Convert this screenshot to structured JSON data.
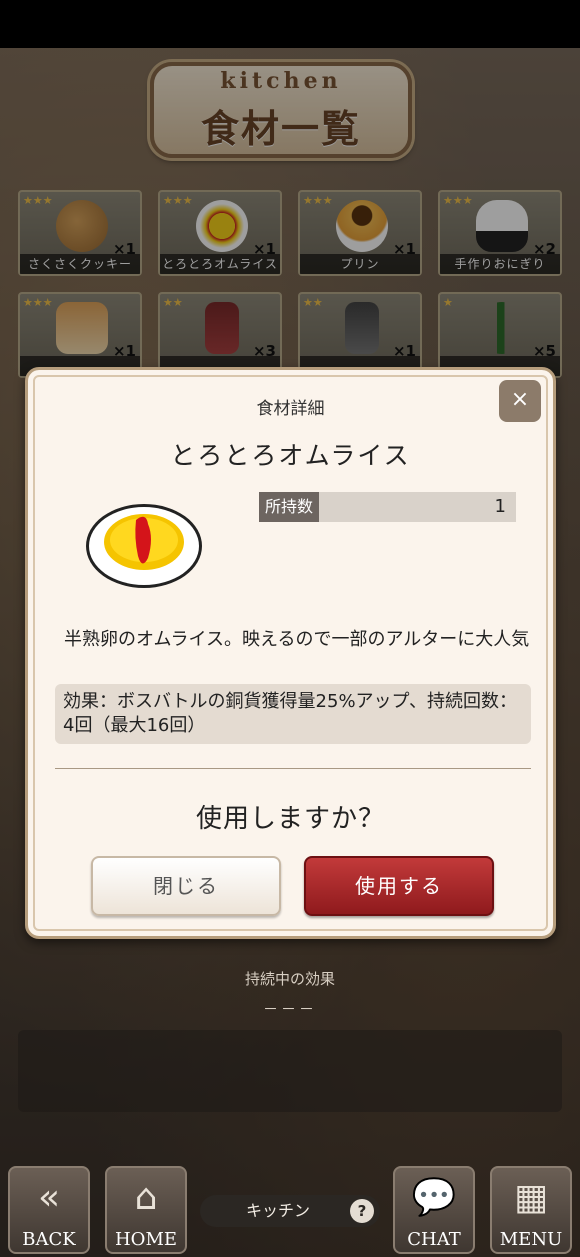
{
  "header": {
    "kitchen_label": "kitchen",
    "title": "食材一覧"
  },
  "ingredients": [
    {
      "name": "さくさくクッキー",
      "qty": "×1",
      "stars": "★★★"
    },
    {
      "name": "とろとろオムライス",
      "qty": "×1",
      "stars": "★★★"
    },
    {
      "name": "プリン",
      "qty": "×1",
      "stars": "★★★"
    },
    {
      "name": "手作りおにぎり",
      "qty": "×2",
      "stars": "★★★"
    },
    {
      "name": "",
      "qty": "×1",
      "stars": "★★★"
    },
    {
      "name": "",
      "qty": "×3",
      "stars": "★★"
    },
    {
      "name": "",
      "qty": "×1",
      "stars": "★★"
    },
    {
      "name": "",
      "qty": "×5",
      "stars": "★"
    }
  ],
  "modal": {
    "title": "食材詳細",
    "close_icon": "×",
    "item_name": "とろとろオムライス",
    "owned_label": "所持数",
    "owned_value": "1",
    "description": "半熟卵のオムライス。映えるので一部のアルターに大人気",
    "effect": "効果：ボスバトルの銅貨獲得量25%アップ、持続回数：4回（最大16回）",
    "confirm_text": "使用しますか？",
    "close_button": "閉じる",
    "use_button": "使用する"
  },
  "effects_panel": {
    "heading": "持続中の効果",
    "none_text": "－－－"
  },
  "nav": {
    "back": "BACK",
    "home": "HOME",
    "location": "キッチン",
    "help": "?",
    "chat": "CHAT",
    "menu": "MENU"
  },
  "colors": {
    "use_button": "#b02a2c",
    "star": "#f4c24a"
  }
}
